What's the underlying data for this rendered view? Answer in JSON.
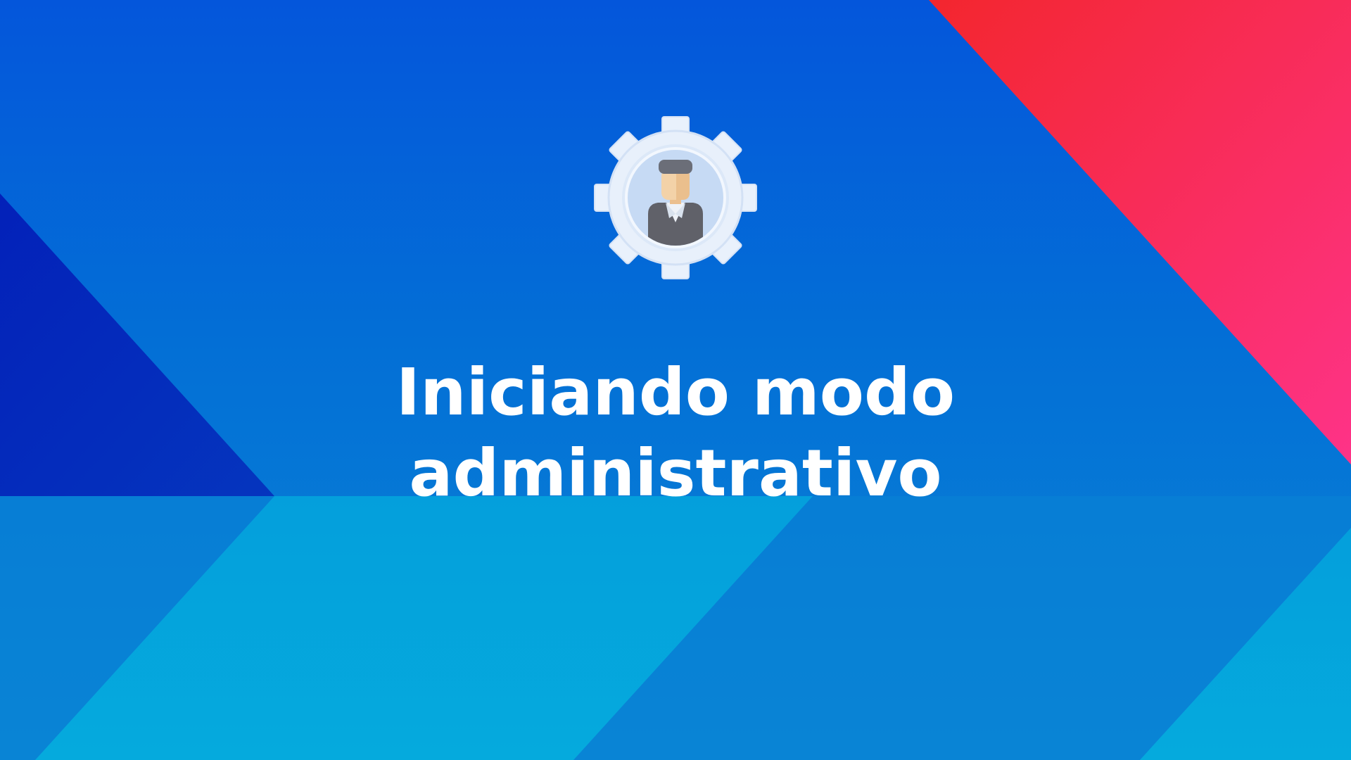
{
  "screen": {
    "title_line_1": "Iniciando modo",
    "title_line_2": "administrativo"
  },
  "icon": {
    "name": "admin-gear-user-icon"
  },
  "colors": {
    "background_blue": "#0456db",
    "background_lower_blue": "#0a86d4",
    "dark_blue_shape": "#0327bb",
    "light_cyan_shape": "#04a6dd",
    "red_pink_corner_start": "#f3262e",
    "red_pink_corner_end": "#fe3388",
    "title_text": "#ffffff",
    "gear": "#e8f0fb",
    "gear_inner": "#c9dcf5",
    "person_hair": "#6b6e78",
    "person_skin": "#f3d2a8",
    "person_suit": "#5f6168"
  }
}
